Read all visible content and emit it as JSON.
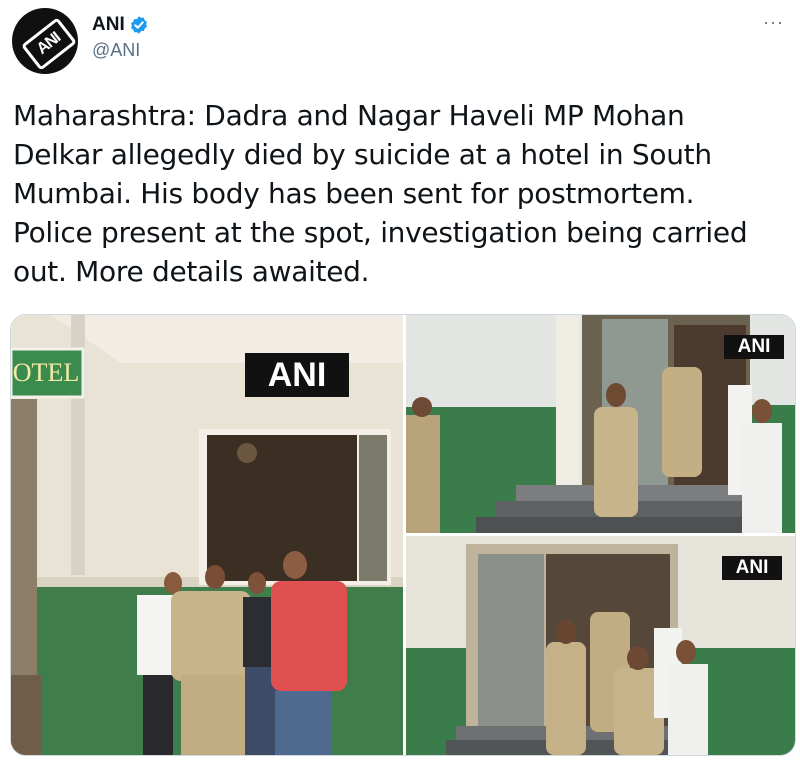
{
  "account": {
    "name": "ANI",
    "handle": "@ANI",
    "avatar_text": "ANI"
  },
  "more_label": "···",
  "tweet": {
    "lines": [
      "Maharashtra: Dadra and Nagar Haveli MP Mohan",
      "Delkar allegedly died by suicide at a hotel in South",
      "Mumbai. His body has been sent for postmortem.",
      "Police present at the spot, investigation being carried",
      "out. More details awaited."
    ]
  },
  "photos": {
    "left": {
      "watermark": "ANI",
      "sign_text": "OTEL"
    },
    "top_right": {
      "watermark": "ANI"
    },
    "bottom_right": {
      "watermark": "ANI"
    }
  },
  "colors": {
    "verified": "#1d9bf0",
    "wall_green": "#3f7d4a",
    "khaki": "#c8b48a"
  }
}
